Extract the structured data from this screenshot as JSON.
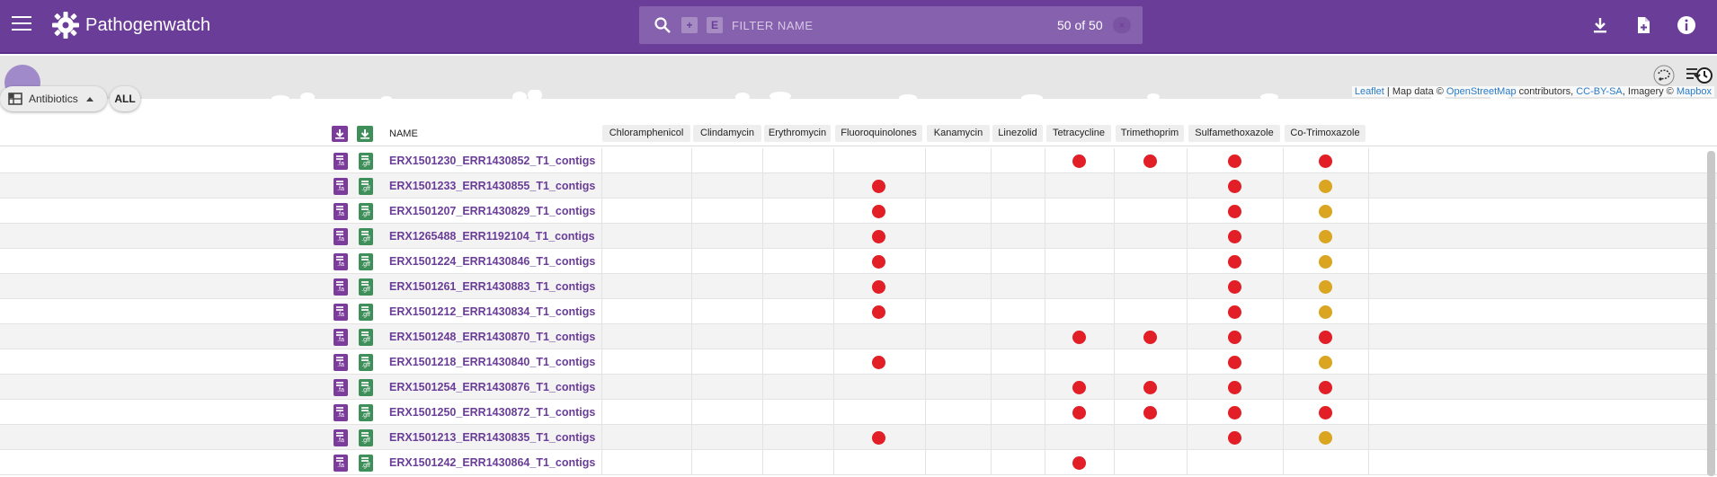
{
  "header": {
    "logo_text": "Pathogenwatch",
    "search_placeholder": "FILTER NAME",
    "search_count": "50 of 50",
    "plus_label": "+",
    "e_label": "E",
    "clear_label": "×"
  },
  "map": {
    "attribution": {
      "leaflet": "Leaflet",
      "map_data": " | Map data © ",
      "osm": "OpenStreetMap",
      "contributors": " contributors, ",
      "license": "CC-BY-SA",
      "imagery": ", Imagery © ",
      "mapbox": "Mapbox"
    }
  },
  "controls": {
    "antibiotics_label": "Antibiotics",
    "all_label": "ALL"
  },
  "table": {
    "name_header": "NAME",
    "fa_label": ".fa",
    "gff_label": ".gff",
    "columns": [
      "Chloramphenicol",
      "Clindamycin",
      "Erythromycin",
      "Fluoroquinolones",
      "Kanamycin",
      "Linezolid",
      "Tetracycline",
      "Trimethoprim",
      "Sulfamethoxazole",
      "Co-Trimoxazole"
    ],
    "colors": {
      "resistant": "#e21f26",
      "intermediate": "#daa520"
    },
    "rows": [
      {
        "name": "ERX1501230_ERR1430852_T1_contigs",
        "marks": [
          "",
          "",
          "",
          "",
          "",
          "",
          "R",
          "R",
          "R",
          "R"
        ]
      },
      {
        "name": "ERX1501233_ERR1430855_T1_contigs",
        "marks": [
          "",
          "",
          "",
          "R",
          "",
          "",
          "",
          "",
          "R",
          "I"
        ]
      },
      {
        "name": "ERX1501207_ERR1430829_T1_contigs",
        "marks": [
          "",
          "",
          "",
          "R",
          "",
          "",
          "",
          "",
          "R",
          "I"
        ]
      },
      {
        "name": "ERX1265488_ERR1192104_T1_contigs",
        "marks": [
          "",
          "",
          "",
          "R",
          "",
          "",
          "",
          "",
          "R",
          "I"
        ]
      },
      {
        "name": "ERX1501224_ERR1430846_T1_contigs",
        "marks": [
          "",
          "",
          "",
          "R",
          "",
          "",
          "",
          "",
          "R",
          "I"
        ]
      },
      {
        "name": "ERX1501261_ERR1430883_T1_contigs",
        "marks": [
          "",
          "",
          "",
          "R",
          "",
          "",
          "",
          "",
          "R",
          "I"
        ]
      },
      {
        "name": "ERX1501212_ERR1430834_T1_contigs",
        "marks": [
          "",
          "",
          "",
          "R",
          "",
          "",
          "",
          "",
          "R",
          "I"
        ]
      },
      {
        "name": "ERX1501248_ERR1430870_T1_contigs",
        "marks": [
          "",
          "",
          "",
          "",
          "",
          "",
          "R",
          "R",
          "R",
          "R"
        ]
      },
      {
        "name": "ERX1501218_ERR1430840_T1_contigs",
        "marks": [
          "",
          "",
          "",
          "R",
          "",
          "",
          "",
          "",
          "R",
          "I"
        ]
      },
      {
        "name": "ERX1501254_ERR1430876_T1_contigs",
        "marks": [
          "",
          "",
          "",
          "",
          "",
          "",
          "R",
          "R",
          "R",
          "R"
        ]
      },
      {
        "name": "ERX1501250_ERR1430872_T1_contigs",
        "marks": [
          "",
          "",
          "",
          "",
          "",
          "",
          "R",
          "R",
          "R",
          "R"
        ]
      },
      {
        "name": "ERX1501213_ERR1430835_T1_contigs",
        "marks": [
          "",
          "",
          "",
          "R",
          "",
          "",
          "",
          "",
          "R",
          "I"
        ]
      },
      {
        "name": "ERX1501242_ERR1430864_T1_contigs",
        "marks": [
          "",
          "",
          "",
          "",
          "",
          "",
          "R",
          "",
          "",
          ""
        ]
      }
    ]
  }
}
